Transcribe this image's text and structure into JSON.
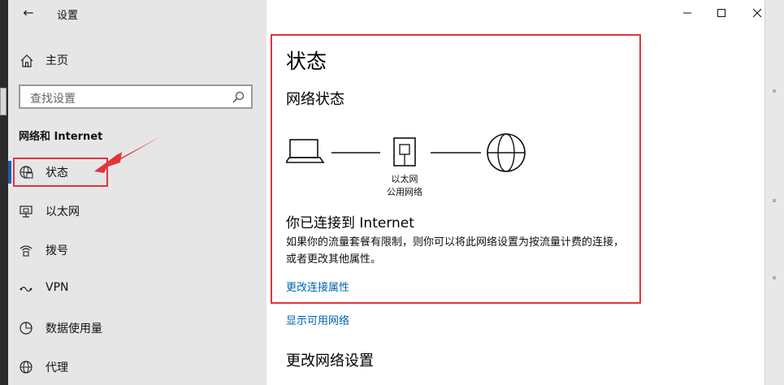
{
  "window": {
    "title": "设置",
    "back": "←"
  },
  "sidebar": {
    "home_label": "主页",
    "search_placeholder": "查找设置",
    "section_title": "网络和 Internet",
    "items": [
      {
        "label": "状态",
        "icon": "globe-status-icon",
        "active": true
      },
      {
        "label": "以太网",
        "icon": "ethernet-icon"
      },
      {
        "label": "拨号",
        "icon": "dialup-icon"
      },
      {
        "label": "VPN",
        "icon": "vpn-icon"
      },
      {
        "label": "数据使用量",
        "icon": "data-usage-icon"
      },
      {
        "label": "代理",
        "icon": "globe-icon"
      }
    ]
  },
  "main": {
    "title": "状态",
    "subtitle": "网络状态",
    "diagram": {
      "adapter_label": "以太网",
      "network_label": "公用网络"
    },
    "connected_text": "你已连接到 Internet",
    "description": "如果你的流量套餐有限制，则你可以将此网络设置为按流量计费的连接，或者更改其他属性。",
    "link_change_properties": "更改连接属性",
    "link_show_networks": "显示可用网络",
    "section_change": "更改网络设置"
  },
  "colors": {
    "accent": "#0063b1",
    "highlight": "#e3343c",
    "sidebar_bg": "#e6e6e6"
  }
}
